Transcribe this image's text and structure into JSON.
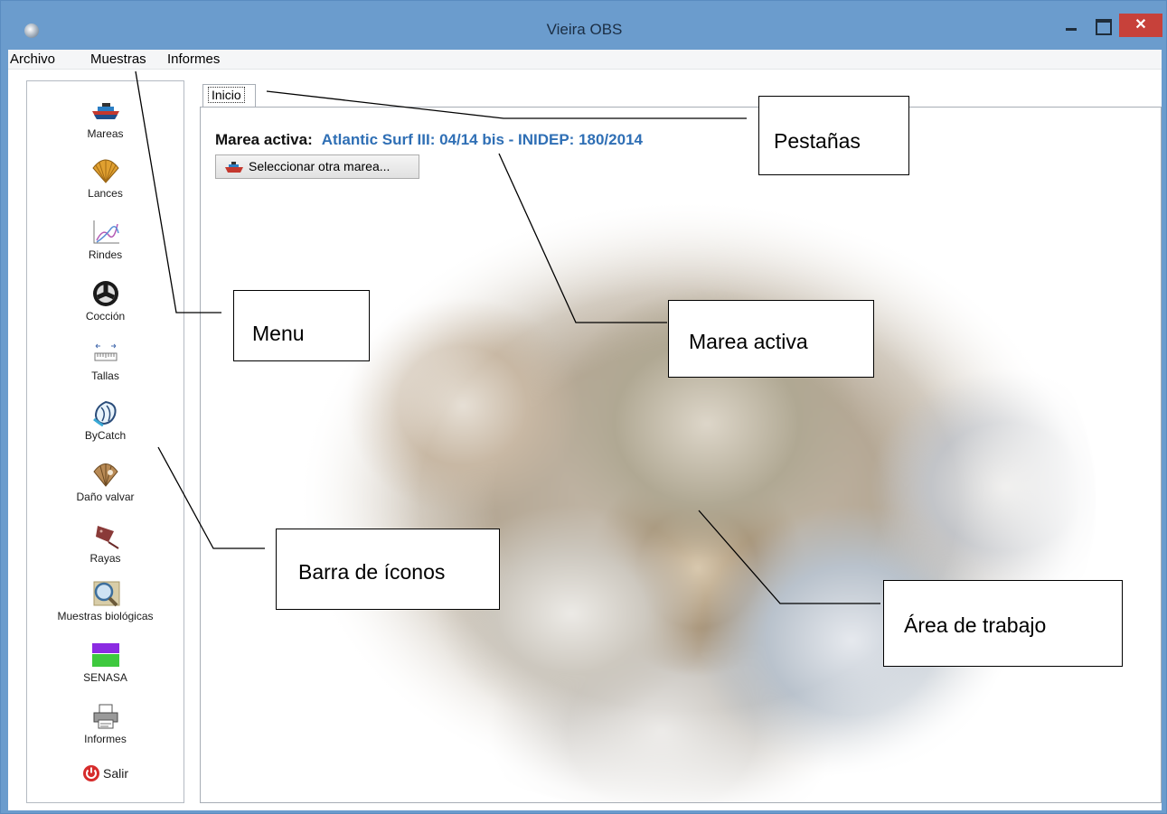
{
  "window": {
    "title": "Vieira OBS",
    "close_glyph": "✕"
  },
  "menu": {
    "items": [
      "Archivo",
      "Muestras",
      "Informes"
    ]
  },
  "sidebar": {
    "items": [
      {
        "label": "Mareas",
        "icon": "ship-icon"
      },
      {
        "label": "Lances",
        "icon": "scallop-icon"
      },
      {
        "label": "Rindes",
        "icon": "line-chart-icon"
      },
      {
        "label": "Cocción",
        "icon": "wheel-icon"
      },
      {
        "label": "Tallas",
        "icon": "ruler-icon"
      },
      {
        "label": "ByCatch",
        "icon": "bycatch-icon"
      },
      {
        "label": "Daño valvar",
        "icon": "damaged-shell-icon"
      },
      {
        "label": "Rayas",
        "icon": "ray-fish-icon"
      },
      {
        "label": "Muestras biológicas",
        "icon": "magnifier-icon"
      },
      {
        "label": "SENASA",
        "icon": "senasa-icon"
      },
      {
        "label": "Informes",
        "icon": "printer-icon"
      }
    ],
    "exit_label": "Salir"
  },
  "tabs": [
    {
      "label": "Inicio",
      "active": true
    }
  ],
  "workspace": {
    "marea_label": "Marea activa:",
    "marea_value": "Atlantic Surf III: 04/14 bis - INIDEP: 180/2014",
    "select_button": "Seleccionar otra marea..."
  },
  "callouts": {
    "pestanas": "Pestañas",
    "menu": "Menu",
    "marea_activa": "Marea activa",
    "barra_iconos": "Barra de íconos",
    "area_trabajo": "Área de trabajo"
  },
  "colors": {
    "accent": "#2f6fb5",
    "titlebar": "#6b9ccd",
    "close": "#c7413a"
  }
}
